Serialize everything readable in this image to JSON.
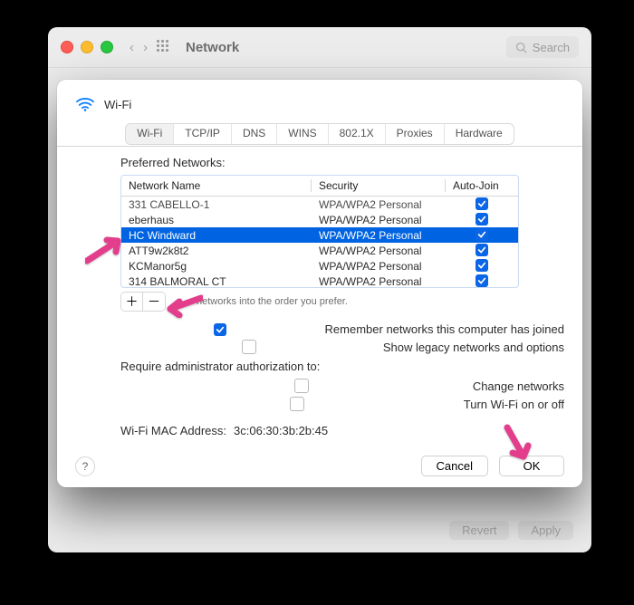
{
  "window": {
    "title": "Network",
    "search_placeholder": "Search",
    "footer": {
      "revert": "Revert",
      "apply": "Apply"
    }
  },
  "sheet": {
    "icon": "wifi-icon",
    "title": "Wi-Fi",
    "tabs": [
      "Wi-Fi",
      "TCP/IP",
      "DNS",
      "WINS",
      "802.1X",
      "Proxies",
      "Hardware"
    ],
    "active_tab": 0,
    "table": {
      "label": "Preferred Networks:",
      "cols": [
        "Network Name",
        "Security",
        "Auto-Join"
      ],
      "rows": [
        {
          "name": "331 CABELLO-1",
          "security": "WPA/WPA2 Personal",
          "autojoin": true,
          "clipped": true
        },
        {
          "name": "eberhaus",
          "security": "WPA/WPA2 Personal",
          "autojoin": true
        },
        {
          "name": "HC Windward",
          "security": "WPA/WPA2 Personal",
          "autojoin": true,
          "selected": true
        },
        {
          "name": "ATT9w2k8t2",
          "security": "WPA/WPA2 Personal",
          "autojoin": true
        },
        {
          "name": "KCManor5g",
          "security": "WPA/WPA2 Personal",
          "autojoin": true
        },
        {
          "name": "314 BALMORAL CT",
          "security": "WPA/WPA2 Personal",
          "autojoin": true
        }
      ],
      "add": "＋",
      "remove": "－",
      "drag_hint": "networks into the order you prefer."
    },
    "options": {
      "remember": {
        "label": "Remember networks this computer has joined",
        "checked": true
      },
      "legacy": {
        "label": "Show legacy networks and options",
        "checked": false
      },
      "require": {
        "label": "Require administrator authorization to:"
      },
      "change": {
        "label": "Change networks",
        "checked": false
      },
      "toggle": {
        "label": "Turn Wi-Fi on or off",
        "checked": false
      }
    },
    "mac": {
      "label": "Wi-Fi MAC Address:",
      "value": "3c:06:30:3b:2b:45"
    },
    "help": "?",
    "buttons": {
      "cancel": "Cancel",
      "ok": "OK"
    }
  }
}
